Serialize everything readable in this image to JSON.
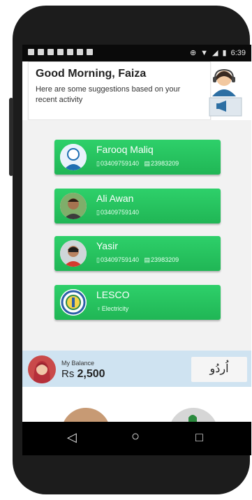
{
  "status_bar": {
    "time": "6:39"
  },
  "greeting": {
    "title": "Good Morning, Faiza",
    "subtitle": "Here are some suggestions based on your recent activity"
  },
  "contacts": [
    {
      "name": "Farooq Maliq",
      "phone": "03409759140",
      "account": "23983209",
      "avatar": "person-placeholder-icon"
    },
    {
      "name": "Ali Awan",
      "phone": "03409759140",
      "avatar": "photo"
    },
    {
      "name": "Yasir",
      "phone": "03409759140",
      "account": "23983209",
      "avatar": "photo"
    },
    {
      "name": "LESCO",
      "category": "Electricity",
      "avatar": "lesco-logo"
    }
  ],
  "balance": {
    "label": "My Balance",
    "currency": "Rs",
    "amount": "2,500"
  },
  "language_button": {
    "label": "اُردُو"
  },
  "colors": {
    "card_green": "#26c15e",
    "balance_bar": "#cfe3f1",
    "status_bar": "#0a0a0a"
  },
  "nav": {
    "back_icon": "◁",
    "home_icon": "○",
    "recents_icon": "□"
  }
}
